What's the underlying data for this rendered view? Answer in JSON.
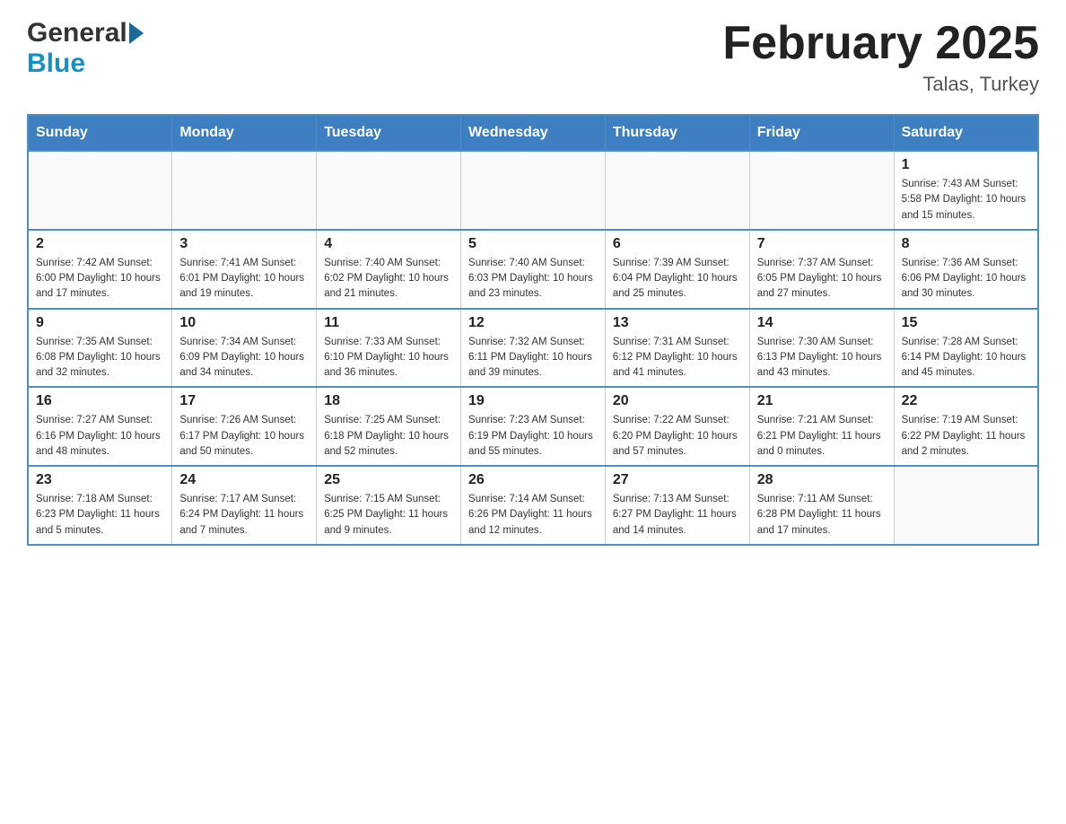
{
  "header": {
    "logo": {
      "line1": "General",
      "line2": "Blue"
    },
    "title": "February 2025",
    "location": "Talas, Turkey"
  },
  "calendar": {
    "days_of_week": [
      "Sunday",
      "Monday",
      "Tuesday",
      "Wednesday",
      "Thursday",
      "Friday",
      "Saturday"
    ],
    "weeks": [
      [
        {
          "day": "",
          "info": ""
        },
        {
          "day": "",
          "info": ""
        },
        {
          "day": "",
          "info": ""
        },
        {
          "day": "",
          "info": ""
        },
        {
          "day": "",
          "info": ""
        },
        {
          "day": "",
          "info": ""
        },
        {
          "day": "1",
          "info": "Sunrise: 7:43 AM\nSunset: 5:58 PM\nDaylight: 10 hours\nand 15 minutes."
        }
      ],
      [
        {
          "day": "2",
          "info": "Sunrise: 7:42 AM\nSunset: 6:00 PM\nDaylight: 10 hours\nand 17 minutes."
        },
        {
          "day": "3",
          "info": "Sunrise: 7:41 AM\nSunset: 6:01 PM\nDaylight: 10 hours\nand 19 minutes."
        },
        {
          "day": "4",
          "info": "Sunrise: 7:40 AM\nSunset: 6:02 PM\nDaylight: 10 hours\nand 21 minutes."
        },
        {
          "day": "5",
          "info": "Sunrise: 7:40 AM\nSunset: 6:03 PM\nDaylight: 10 hours\nand 23 minutes."
        },
        {
          "day": "6",
          "info": "Sunrise: 7:39 AM\nSunset: 6:04 PM\nDaylight: 10 hours\nand 25 minutes."
        },
        {
          "day": "7",
          "info": "Sunrise: 7:37 AM\nSunset: 6:05 PM\nDaylight: 10 hours\nand 27 minutes."
        },
        {
          "day": "8",
          "info": "Sunrise: 7:36 AM\nSunset: 6:06 PM\nDaylight: 10 hours\nand 30 minutes."
        }
      ],
      [
        {
          "day": "9",
          "info": "Sunrise: 7:35 AM\nSunset: 6:08 PM\nDaylight: 10 hours\nand 32 minutes."
        },
        {
          "day": "10",
          "info": "Sunrise: 7:34 AM\nSunset: 6:09 PM\nDaylight: 10 hours\nand 34 minutes."
        },
        {
          "day": "11",
          "info": "Sunrise: 7:33 AM\nSunset: 6:10 PM\nDaylight: 10 hours\nand 36 minutes."
        },
        {
          "day": "12",
          "info": "Sunrise: 7:32 AM\nSunset: 6:11 PM\nDaylight: 10 hours\nand 39 minutes."
        },
        {
          "day": "13",
          "info": "Sunrise: 7:31 AM\nSunset: 6:12 PM\nDaylight: 10 hours\nand 41 minutes."
        },
        {
          "day": "14",
          "info": "Sunrise: 7:30 AM\nSunset: 6:13 PM\nDaylight: 10 hours\nand 43 minutes."
        },
        {
          "day": "15",
          "info": "Sunrise: 7:28 AM\nSunset: 6:14 PM\nDaylight: 10 hours\nand 45 minutes."
        }
      ],
      [
        {
          "day": "16",
          "info": "Sunrise: 7:27 AM\nSunset: 6:16 PM\nDaylight: 10 hours\nand 48 minutes."
        },
        {
          "day": "17",
          "info": "Sunrise: 7:26 AM\nSunset: 6:17 PM\nDaylight: 10 hours\nand 50 minutes."
        },
        {
          "day": "18",
          "info": "Sunrise: 7:25 AM\nSunset: 6:18 PM\nDaylight: 10 hours\nand 52 minutes."
        },
        {
          "day": "19",
          "info": "Sunrise: 7:23 AM\nSunset: 6:19 PM\nDaylight: 10 hours\nand 55 minutes."
        },
        {
          "day": "20",
          "info": "Sunrise: 7:22 AM\nSunset: 6:20 PM\nDaylight: 10 hours\nand 57 minutes."
        },
        {
          "day": "21",
          "info": "Sunrise: 7:21 AM\nSunset: 6:21 PM\nDaylight: 11 hours\nand 0 minutes."
        },
        {
          "day": "22",
          "info": "Sunrise: 7:19 AM\nSunset: 6:22 PM\nDaylight: 11 hours\nand 2 minutes."
        }
      ],
      [
        {
          "day": "23",
          "info": "Sunrise: 7:18 AM\nSunset: 6:23 PM\nDaylight: 11 hours\nand 5 minutes."
        },
        {
          "day": "24",
          "info": "Sunrise: 7:17 AM\nSunset: 6:24 PM\nDaylight: 11 hours\nand 7 minutes."
        },
        {
          "day": "25",
          "info": "Sunrise: 7:15 AM\nSunset: 6:25 PM\nDaylight: 11 hours\nand 9 minutes."
        },
        {
          "day": "26",
          "info": "Sunrise: 7:14 AM\nSunset: 6:26 PM\nDaylight: 11 hours\nand 12 minutes."
        },
        {
          "day": "27",
          "info": "Sunrise: 7:13 AM\nSunset: 6:27 PM\nDaylight: 11 hours\nand 14 minutes."
        },
        {
          "day": "28",
          "info": "Sunrise: 7:11 AM\nSunset: 6:28 PM\nDaylight: 11 hours\nand 17 minutes."
        },
        {
          "day": "",
          "info": ""
        }
      ]
    ]
  }
}
